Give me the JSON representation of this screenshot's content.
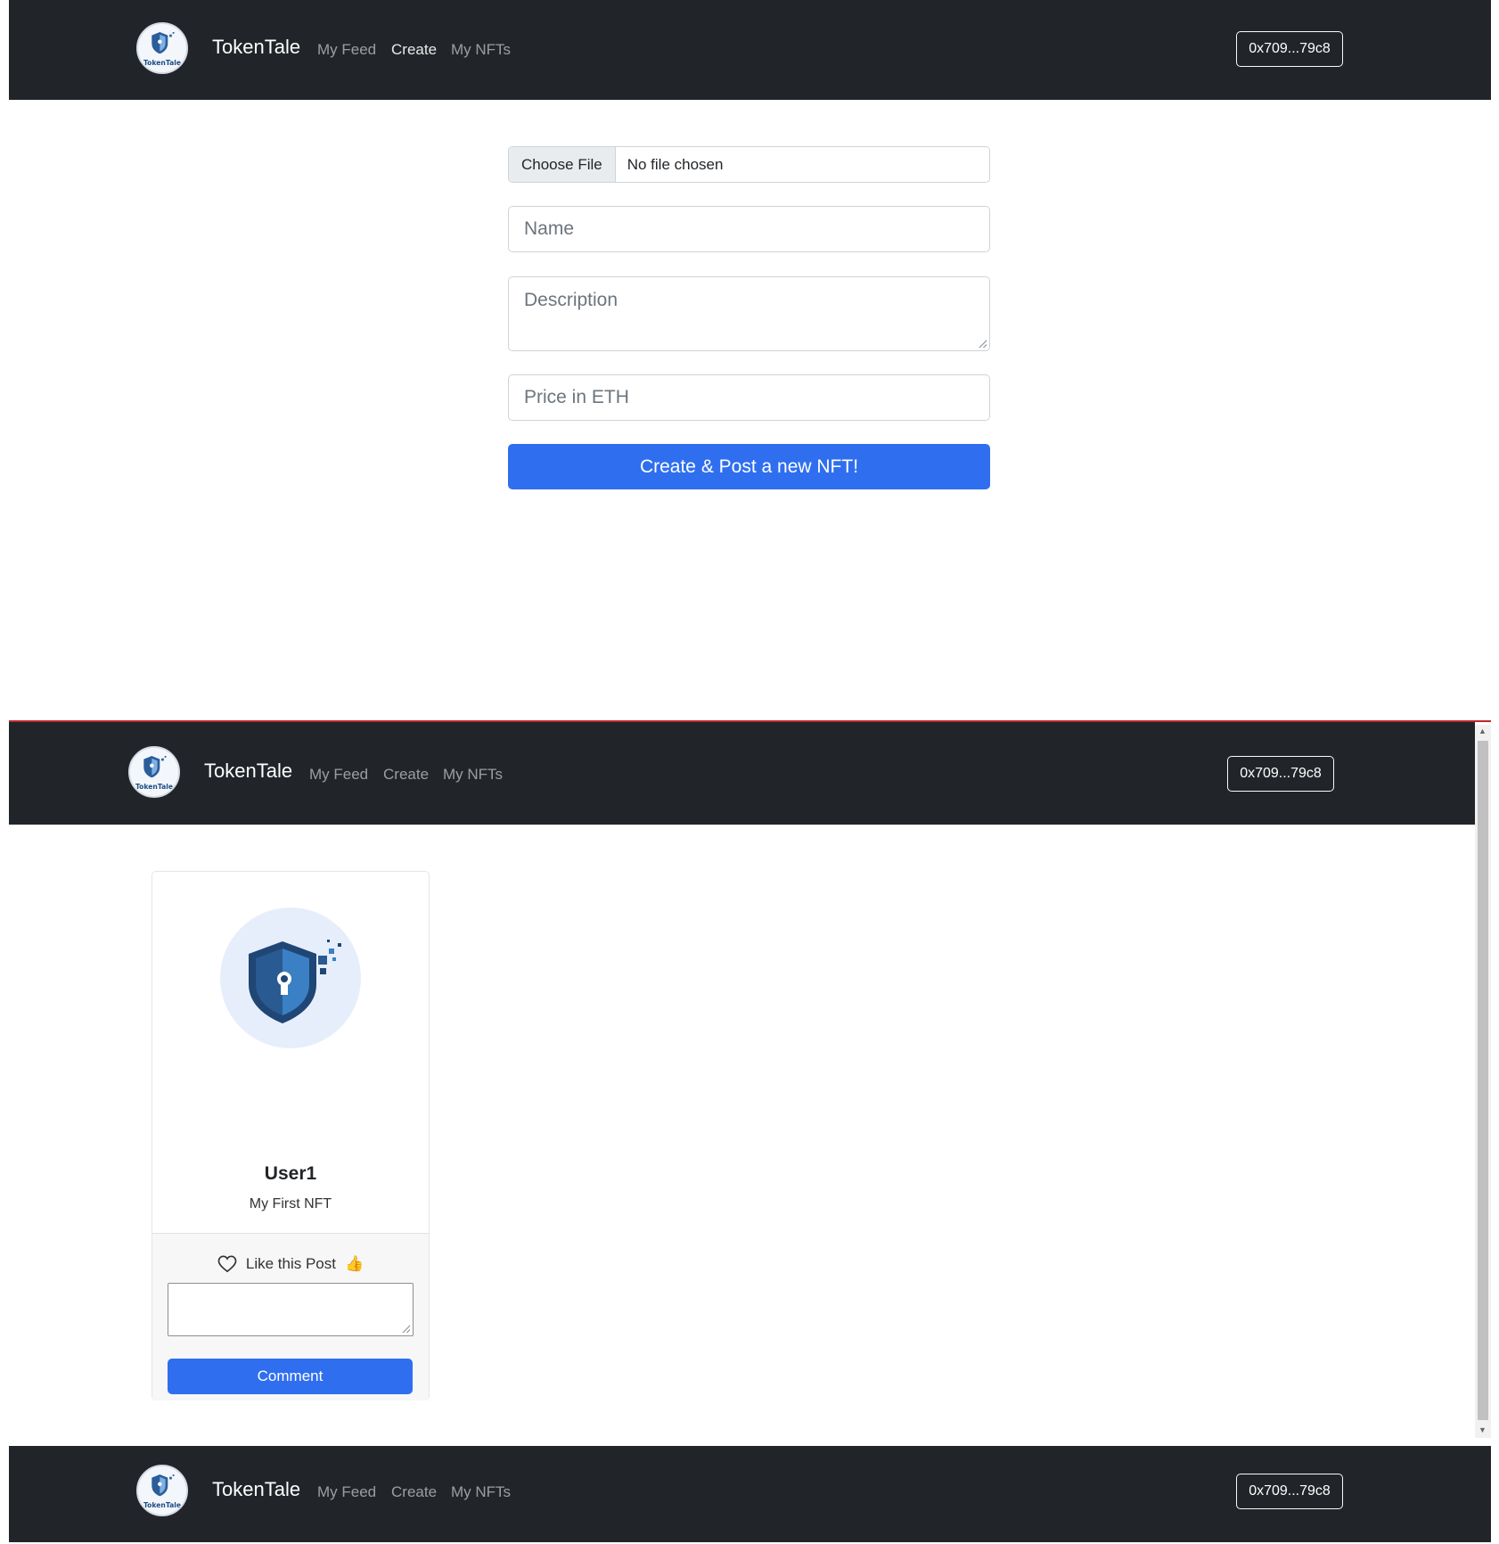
{
  "navbar": {
    "brand": "TokenTale",
    "logo_text": "TokenTale",
    "links": [
      "My Feed",
      "Create",
      "My NFTs"
    ],
    "wallet": "0x709...79c8"
  },
  "create_form": {
    "file_button": "Choose File",
    "file_status": "No file chosen",
    "name_placeholder": "Name",
    "description_placeholder": "Description",
    "price_placeholder": "Price in ETH",
    "submit_label": "Create & Post a new NFT!"
  },
  "feed": {
    "card": {
      "title": "User1",
      "description": "My First NFT",
      "like_label": "Like this Post",
      "like_emoji": "👍",
      "comment_value": "",
      "comment_button": "Comment"
    }
  },
  "colors": {
    "navbar_bg": "#212529",
    "primary": "#2f6fef",
    "divider": "#c0262c"
  }
}
